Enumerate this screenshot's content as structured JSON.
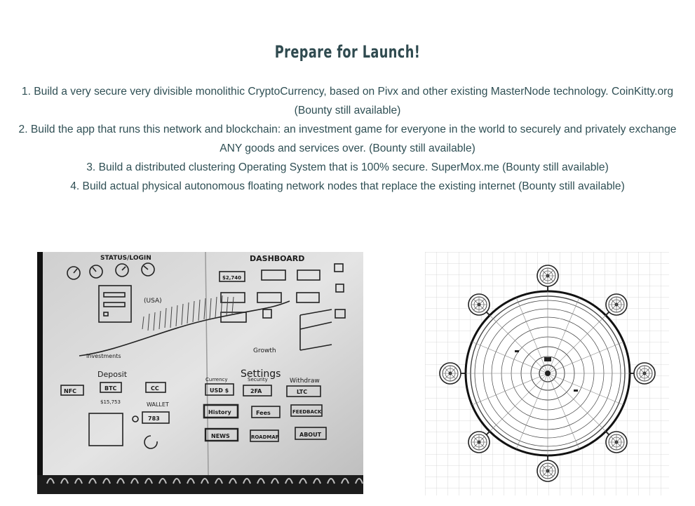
{
  "heading": "Prepare for Launch!",
  "items": [
    "1. Build a very secure very divisible monolithic CryptoCurrency, based on Pivx and other existing MasterNode technology. CoinKitty.org (Bounty still available)",
    "2. Build the app that runs this network and blockchain: an investment game for everyone in the world to securely and privately exchange ANY goods and services over.  (Bounty still available)",
    "3. Build a distributed clustering Operating System that is 100% secure. SuperMox.me (Bounty still available)",
    "4. Build actual physical autonomous floating network nodes  that replace the existing internet (Bounty still available)"
  ],
  "sketch": {
    "sections": [
      "STATUS/LOGIN",
      "DASHBOARD",
      "Settings"
    ],
    "labels": [
      "Deposit",
      "Withdraw",
      "Growth",
      "Investments",
      "WALLET",
      "NFC",
      "BTC",
      "CC",
      "USD $",
      "2FA",
      "LTC",
      "History",
      "Fees",
      "FEEDBACK",
      "NEWS",
      "ROADMAP",
      "ABOUT",
      "Currency",
      "Security",
      "783",
      "$2,740",
      "(USA)",
      "$15,753"
    ]
  },
  "colors": {
    "text": "#2f4f54",
    "heading": "#2f4a4f"
  }
}
